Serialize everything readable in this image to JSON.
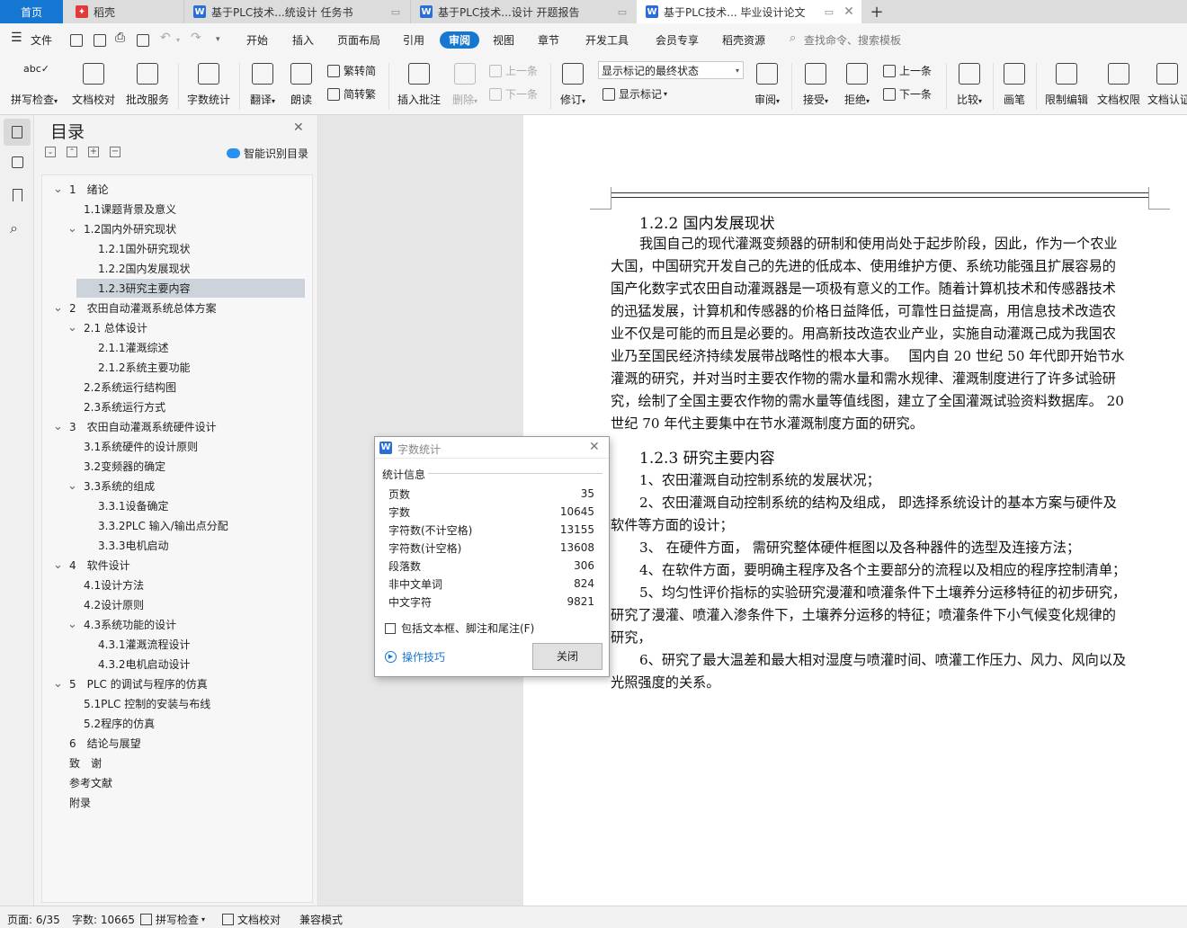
{
  "tabs": [
    {
      "label": "首页"
    },
    {
      "label": "稻壳"
    },
    {
      "label": "基于PLC技术...统设计 任务书"
    },
    {
      "label": "基于PLC技术...设计 开题报告"
    },
    {
      "label": "基于PLC技术... 毕业设计论文"
    }
  ],
  "menu": {
    "file": "文件",
    "items": [
      "开始",
      "插入",
      "页面布局",
      "引用",
      "审阅",
      "视图",
      "章节",
      "开发工具",
      "会员专享",
      "稻壳资源"
    ],
    "active": "审阅",
    "search_placeholder": "查找命令、搜索模板"
  },
  "ribbon": {
    "spell_check": "拼写检查",
    "doc_check": "文档校对",
    "batch_service": "批改服务",
    "word_count": "字数统计",
    "translate": "翻译",
    "read_aloud": "朗读",
    "simp_to_trad": "繁转简",
    "trad_to_simp": "简转繁",
    "insert_comment": "插入批注",
    "delete": "删除",
    "prev_comment": "上一条",
    "next_comment": "下一条",
    "revise": "修订",
    "markup_select": "显示标记的最终状态",
    "show_markup": "显示标记",
    "review": "审阅",
    "accept": "接受",
    "reject": "拒绝",
    "prev": "上一条",
    "next": "下一条",
    "compare": "比较",
    "pen": "画笔",
    "restrict_edit": "限制编辑",
    "doc_rights": "文档权限",
    "doc_cert": "文档认证"
  },
  "toc": {
    "title": "目录",
    "smart_label": "智能识别目录",
    "items": [
      {
        "text": "1　绪论",
        "level": 0,
        "caret": true
      },
      {
        "text": "1.1课题背景及意义",
        "level": 1,
        "caret": false
      },
      {
        "text": "1.2国内外研究现状",
        "level": 1,
        "caret": true
      },
      {
        "text": "1.2.1国外研究现状",
        "level": 2,
        "caret": false
      },
      {
        "text": "1.2.2国内发展现状",
        "level": 2,
        "caret": false
      },
      {
        "text": "1.2.3研究主要内容",
        "level": 2,
        "caret": false,
        "selected": true
      },
      {
        "text": "2　农田自动灌溉系统总体方案",
        "level": 0,
        "caret": true
      },
      {
        "text": "2.1  总体设计",
        "level": 1,
        "caret": true
      },
      {
        "text": "2.1.1灌溉综述",
        "level": 2,
        "caret": false
      },
      {
        "text": "2.1.2系统主要功能",
        "level": 2,
        "caret": false
      },
      {
        "text": "2.2系统运行结构图",
        "level": 1,
        "caret": false
      },
      {
        "text": "2.3系统运行方式",
        "level": 1,
        "caret": false
      },
      {
        "text": "3　农田自动灌溉系统硬件设计",
        "level": 0,
        "caret": true
      },
      {
        "text": "3.1系统硬件的设计原则",
        "level": 1,
        "caret": false
      },
      {
        "text": "3.2变频器的确定",
        "level": 1,
        "caret": false
      },
      {
        "text": "3.3系统的组成",
        "level": 1,
        "caret": true
      },
      {
        "text": "3.3.1设备确定",
        "level": 2,
        "caret": false
      },
      {
        "text": "3.3.2PLC 输入/输出点分配",
        "level": 2,
        "caret": false
      },
      {
        "text": "3.3.3电机启动",
        "level": 2,
        "caret": false
      },
      {
        "text": "4　软件设计",
        "level": 0,
        "caret": true
      },
      {
        "text": "4.1设计方法",
        "level": 1,
        "caret": false
      },
      {
        "text": "4.2设计原则",
        "level": 1,
        "caret": false
      },
      {
        "text": "4.3系统功能的设计",
        "level": 1,
        "caret": true
      },
      {
        "text": "4.3.1灌溉流程设计",
        "level": 2,
        "caret": false
      },
      {
        "text": "4.3.2电机启动设计",
        "level": 2,
        "caret": false
      },
      {
        "text": "5　PLC 的调试与程序的仿真",
        "level": 0,
        "caret": true
      },
      {
        "text": "5.1PLC 控制的安装与布线",
        "level": 1,
        "caret": false
      },
      {
        "text": "5.2程序的仿真",
        "level": 1,
        "caret": false
      },
      {
        "text": "6　结论与展望",
        "level": 0,
        "caret": false
      },
      {
        "text": "致　谢",
        "level": 0,
        "caret": false
      },
      {
        "text": "参考文献",
        "level": 0,
        "caret": false
      },
      {
        "text": "附录",
        "level": 0,
        "caret": false
      }
    ]
  },
  "doc": {
    "h1": "1.2.2  国内发展现状",
    "p1": [
      "我国自己的现代灌溉变频器的研制和使用尚处于起步阶段，因此，作为一个农业",
      "大国，中国研究开发自己的先进的低成本、使用维护方便、系统功能强且扩展容易的",
      "国产化数字式农田自动灌溉器是一项极有意义的工作。随着计算机技术和传感器技术",
      "的迅猛发展，计算机和传感器的价格日益降低，可靠性日益提高，用信息技术改造农",
      "业不仅是可能的而且是必要的。用高新技改造农业产业，实施自动灌溉己成为我国农",
      "业乃至国民经济持续发展带战略性的根本大事。　 国内自 20 世纪 50 年代即开始节水",
      "灌溉的研究，并对当时主要农作物的需水量和需水规律、灌溉制度进行了许多试验研",
      "究，绘制了全国主要农作物的需水量等值线图，建立了全国灌溉试验资料数据库。 20",
      "世纪 70 年代主要集中在节水灌溉制度方面的研究。"
    ],
    "h2": "1.2.3  研究主要内容",
    "p2": [
      "1、农田灌溉自动控制系统的发展状况；",
      "2、农田灌溉自动控制系统的结构及组成， 即选择系统设计的基本方案与硬件及",
      "软件等方面的设计；",
      "3、 在硬件方面， 需研究整体硬件框图以及各种器件的选型及连接方法；",
      "4、在软件方面，要明确主程序及各个主要部分的流程以及相应的程序控制清单；",
      "5、均匀性评价指标的实验研究漫灌和喷灌条件下土壤养分运移特征的初步研究，",
      "研究了漫灌、喷灌入渗条件下，土壤养分运移的特征；喷灌条件下小气候变化规律的",
      "研究，",
      "6、研究了最大温差和最大相对湿度与喷灌时间、喷灌工作压力、风力、风向以及",
      "光照强度的关系。"
    ]
  },
  "dialog": {
    "title": "字数统计",
    "section": "统计信息",
    "stats": [
      {
        "label": "页数",
        "value": "35"
      },
      {
        "label": "字数",
        "value": "10645"
      },
      {
        "label": "字符数(不计空格)",
        "value": "13155"
      },
      {
        "label": "字符数(计空格)",
        "value": "13608"
      },
      {
        "label": "段落数",
        "value": "306"
      },
      {
        "label": "非中文单词",
        "value": "824"
      },
      {
        "label": "中文字符",
        "value": "9821"
      }
    ],
    "checkbox": "包括文本框、脚注和尾注(F)",
    "tips": "操作技巧",
    "close": "关闭"
  },
  "status": {
    "page": "页面: 6/35",
    "words": "字数: 10665",
    "spell": "拼写检查",
    "doccheck": "文档校对",
    "compat": "兼容模式"
  },
  "colors": {
    "accent": "#1677d2",
    "wps_red": "#e13a3a",
    "doc_blue": "#2b6fd6",
    "selected": "#cdd3db"
  }
}
